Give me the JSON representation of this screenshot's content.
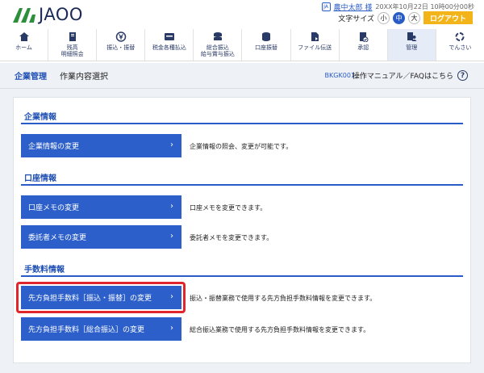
{
  "header": {
    "logo_text": "JAOO",
    "user_icon": "JAOO",
    "user_name": "農中太郎 様",
    "last_login": "20XX年10月22日 10時00分00秒",
    "font_size_label": "文字サイズ",
    "font_sizes": [
      "小",
      "中",
      "大"
    ],
    "logout_label": "ログアウト"
  },
  "nav": [
    {
      "label": "ホーム",
      "icon": "home-icon"
    },
    {
      "label": "残高\n明細照会",
      "icon": "book-icon"
    },
    {
      "label": "振込・振替",
      "icon": "yen-transfer-icon"
    },
    {
      "label": "税金各種払込",
      "icon": "tax-icon"
    },
    {
      "label": "総合振込\n給与賞与振込",
      "icon": "coins-icon"
    },
    {
      "label": "口座振替",
      "icon": "account-transfer-icon"
    },
    {
      "label": "ファイル伝送",
      "icon": "file-icon"
    },
    {
      "label": "承認",
      "icon": "approve-icon"
    },
    {
      "label": "管理",
      "icon": "manage-icon"
    },
    {
      "label": "でんさい",
      "icon": "densai-icon"
    }
  ],
  "titlebar": {
    "section": "企業管理",
    "page": "作業内容選択",
    "code": "BKGK001",
    "help": "操作マニュアル／FAQはこちら"
  },
  "groups": [
    {
      "title": "企業情報",
      "rows": [
        {
          "label": "企業情報の変更",
          "desc": "企業情報の照会、変更が可能です。"
        }
      ]
    },
    {
      "title": "口座情報",
      "rows": [
        {
          "label": "口座メモの変更",
          "desc": "口座メモを変更できます。"
        },
        {
          "label": "委託者メモの変更",
          "desc": "委託者メモを変更できます。"
        }
      ]
    },
    {
      "title": "手数料情報",
      "rows": [
        {
          "label": "先方負担手数料［振込・振替］の変更",
          "desc": "振込・振替業務で使用する先方負担手数料情報を変更できます。"
        },
        {
          "label": "先方負担手数料［総合振込］の変更",
          "desc": "総合振込業務で使用する先方負担手数料情報を変更できます。"
        }
      ]
    }
  ],
  "chevron": "›",
  "colors": {
    "primary": "#2c5fca",
    "accent": "#f3b41a",
    "highlight": "#e0262a",
    "heading": "#1e4fb4"
  }
}
